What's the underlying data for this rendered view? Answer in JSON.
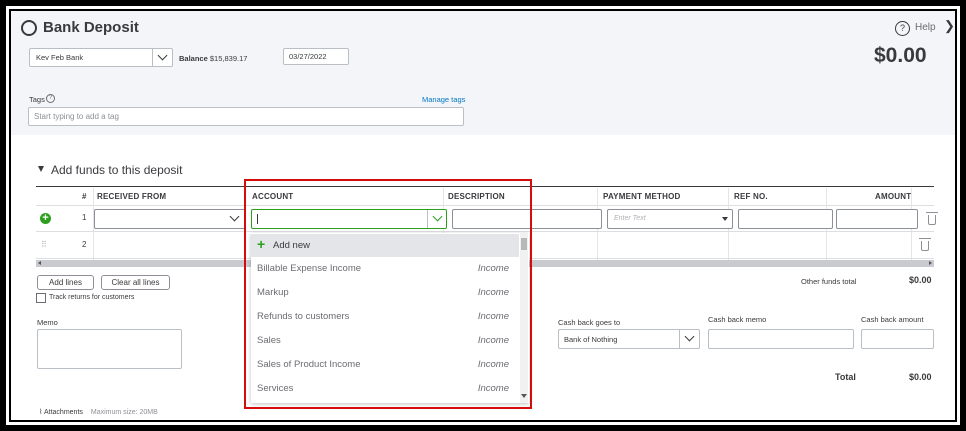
{
  "header": {
    "title": "Bank Deposit",
    "help_label": "Help",
    "account_value": "Kev Feb Bank",
    "balance_label": "Balance",
    "balance_value": "$15,839.17",
    "date_value": "03/27/2022",
    "amount_total": "$0.00",
    "tags_label": "Tags",
    "manage_tags": "Manage tags",
    "tags_placeholder": "Start typing to add a tag"
  },
  "section": {
    "title": "Add funds to this deposit"
  },
  "table": {
    "columns": [
      "#",
      "RECEIVED FROM",
      "ACCOUNT",
      "DESCRIPTION",
      "PAYMENT METHOD",
      "REF NO.",
      "AMOUNT"
    ],
    "rows": [
      {
        "num": "1"
      },
      {
        "num": "2"
      }
    ],
    "payment_placeholder": "Enter Text"
  },
  "dropdown": {
    "add_new": "Add new",
    "items": [
      {
        "name": "Billable Expense Income",
        "type": "Income"
      },
      {
        "name": "Markup",
        "type": "Income"
      },
      {
        "name": "Refunds to customers",
        "type": "Income"
      },
      {
        "name": "Sales",
        "type": "Income"
      },
      {
        "name": "Sales of Product Income",
        "type": "Income"
      },
      {
        "name": "Services",
        "type": "Income"
      }
    ]
  },
  "footer": {
    "add_lines": "Add lines",
    "clear_lines": "Clear all lines",
    "track_returns": "Track returns for customers",
    "other_funds_label": "Other funds total",
    "other_funds_value": "$0.00",
    "memo_label": "Memo",
    "cash_back_goes_to_label": "Cash back goes to",
    "cash_back_goes_to_value": "Bank of Nothing",
    "cash_back_memo_label": "Cash back memo",
    "cash_back_amount_label": "Cash back amount",
    "total_label": "Total",
    "total_value": "$0.00",
    "attachments_label": "Attachments",
    "max_size": "Maximum size: 20MB"
  },
  "colors": {
    "highlight_border": "#d50c0c",
    "add_green": "#2ca01c",
    "link_blue": "#0077c5"
  }
}
